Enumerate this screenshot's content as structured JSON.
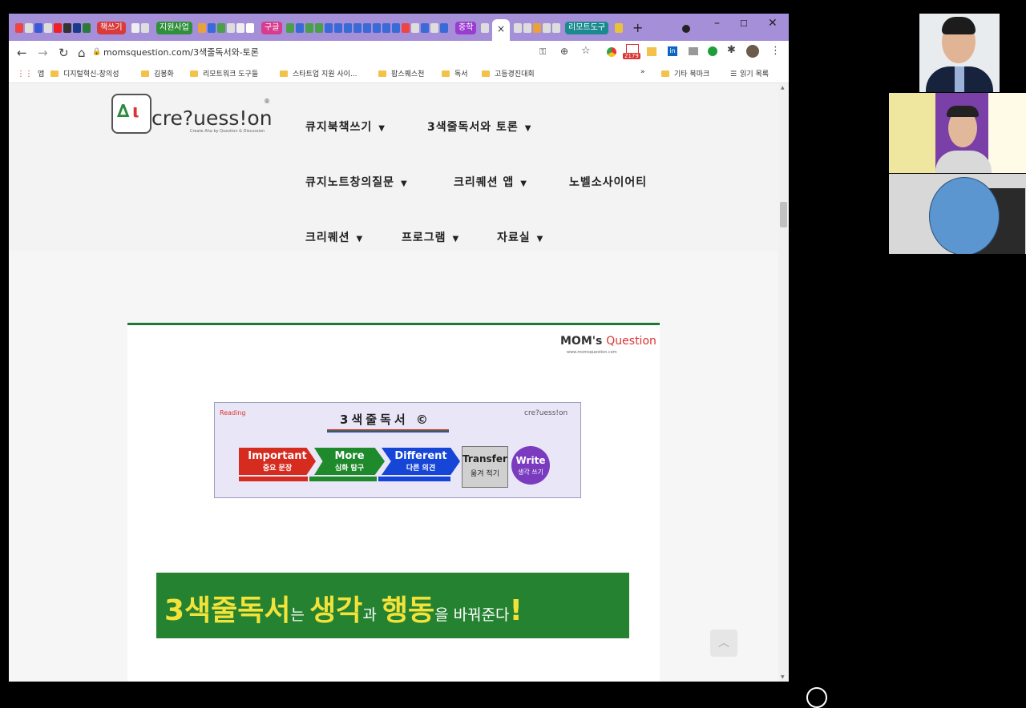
{
  "browser": {
    "tab_groups": [
      {
        "label": "책쓰기",
        "color": "#d93b3b"
      },
      {
        "label": "지원사업",
        "color": "#2f8f3a"
      },
      {
        "label": "구글",
        "color": "#d63d8f"
      },
      {
        "label": "중학",
        "color": "#9a3cd0"
      },
      {
        "label": "리모트도구",
        "color": "#1b8a8f"
      }
    ],
    "active_tab_close": "×",
    "new_tab": "+",
    "window_controls": {
      "minimize": "–",
      "maximize": "☐",
      "close": "✕"
    },
    "url": "momsquestion.com/3색줄독서와-토론",
    "toolbar_icons": [
      "back-icon",
      "forward-icon",
      "reload-icon",
      "home-icon",
      "lock-icon",
      "key-icon",
      "zoom-icon",
      "star-icon",
      "extensions-icon",
      "profile-icon",
      "menu-icon"
    ],
    "gmail_badge": "2179",
    "bookmarks": [
      "앱",
      "디지털혁신-창의성",
      "김봉화",
      "리모트워크 도구들",
      "스타트업 지원 사이...",
      "팝스퀘스천",
      "독서",
      "고등경진대회"
    ],
    "bookmarks_more": "»",
    "bookmarks_right": [
      "기타 북마크",
      "읽기 목록"
    ]
  },
  "site": {
    "logo_text": "cre?uess!on",
    "logo_registered": "®",
    "logo_tagline": "Create Aha by Question & Discussion",
    "menu": [
      "큐지북책쓰기",
      "3색줄독서와 토론",
      "큐지노트창의질문",
      "크리퀘션 앱",
      "노벨소사이어티",
      "크리퀘션",
      "프로그램",
      "자료실"
    ],
    "moms_brand": "MOM's",
    "moms_brand_q": "Question",
    "moms_sub": "www.momsquestion.com",
    "diagram": {
      "left_logo": "Reading",
      "title": "3색줄독서 ©",
      "right_logo": "cre?uess!on",
      "steps": [
        {
          "en": "Important",
          "ko": "중요 문장",
          "color": "#d62b1f"
        },
        {
          "en": "More",
          "ko": "심화 탐구",
          "color": "#1f8a2c"
        },
        {
          "en": "Different",
          "ko": "다른 의견",
          "color": "#1646d8"
        },
        {
          "en": "Transfer",
          "ko": "옮겨 적기",
          "color": "#9b9b9b"
        },
        {
          "en": "Write",
          "ko": "생각 쓰기",
          "color": "#7a3bbf"
        }
      ]
    },
    "banner": {
      "p1": "3색줄독서",
      "p2": "는 ",
      "p3": "생각",
      "p4": "과 ",
      "p5": "행동",
      "p6": "을 바꿔준다",
      "p7": "!"
    },
    "back_to_top": "︿"
  },
  "participants": [
    {
      "name": "participant-1"
    },
    {
      "name": "participant-2"
    },
    {
      "name": "participant-3"
    }
  ]
}
